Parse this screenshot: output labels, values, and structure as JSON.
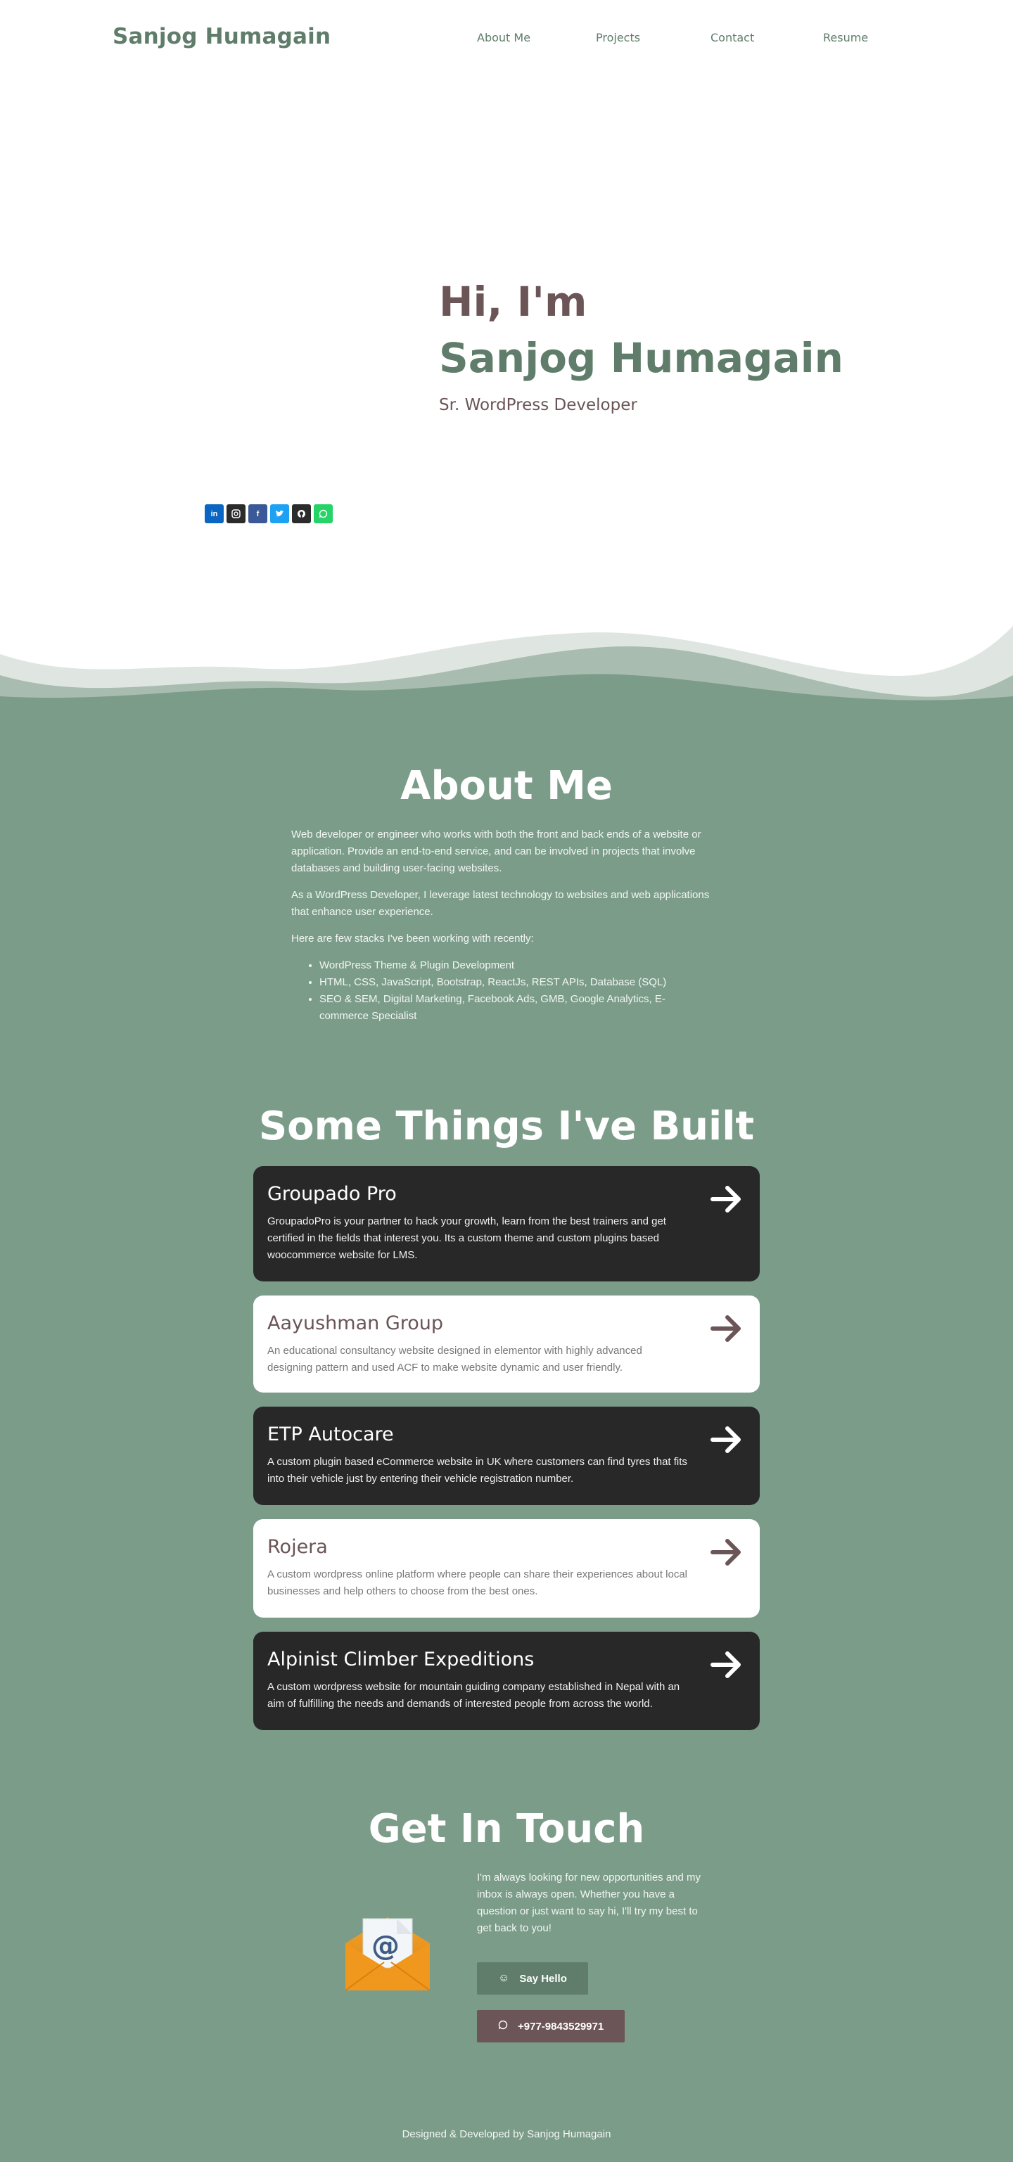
{
  "header": {
    "logo": "Sanjog Humagain",
    "nav": [
      {
        "label": "About Me"
      },
      {
        "label": "Projects"
      },
      {
        "label": "Contact"
      },
      {
        "label": "Resume"
      }
    ]
  },
  "hero": {
    "greeting": "Hi, I'm",
    "name": "Sanjog Humagain",
    "role": "Sr. WordPress Developer",
    "socials": [
      {
        "icon": "linkedin-icon",
        "color": "#0a66c2"
      },
      {
        "icon": "instagram-icon",
        "color": "#2b2b2b"
      },
      {
        "icon": "facebook-icon",
        "color": "#3b5998"
      },
      {
        "icon": "twitter-icon",
        "color": "#1da1f2"
      },
      {
        "icon": "github-icon",
        "color": "#2b2b2b"
      },
      {
        "icon": "whatsapp-icon",
        "color": "#25d366"
      }
    ]
  },
  "about": {
    "title": "About Me",
    "p1": "Web developer or engineer who works with both the front and back ends of a website or application. Provide an end-to-end service, and can be involved in projects that involve databases and building user-facing websites.",
    "p2": "As a WordPress Developer, I leverage latest technology to websites and web applications that enhance user experience.",
    "p3": "Here are few stacks I've been working with recently:",
    "stacks": [
      "WordPress Theme & Plugin Development",
      "HTML, CSS, JavaScript, Bootstrap, ReactJs, REST APIs, Database (SQL)",
      "SEO & SEM, Digital Marketing, Facebook Ads, GMB, Google Analytics, E-commerce Specialist"
    ]
  },
  "projects": {
    "title": "Some Things I've Built",
    "items": [
      {
        "title": "Groupado Pro",
        "desc": "GroupadoPro is your partner to hack your growth, learn from the best trainers and get certified in the fields that interest you. Its a custom theme and custom plugins based woocommerce website for LMS.",
        "style": "dark"
      },
      {
        "title": "Aayushman Group",
        "desc": "An educational consultancy website designed in elementor with highly advanced designing pattern and used ACF to make website dynamic and user friendly.",
        "style": "light"
      },
      {
        "title": "ETP Autocare",
        "desc": "A custom plugin based eCommerce website in UK where customers can find tyres that fits into their vehicle just by entering their vehicle registration number.",
        "style": "dark"
      },
      {
        "title": "Rojera",
        "desc": "A custom wordpress online platform where people can share their experiences about local businesses and help others to choose from the best ones.",
        "style": "light"
      },
      {
        "title": "Alpinist Climber Expeditions",
        "desc": "A custom wordpress website for mountain guiding company established in Nepal with an aim of fulfilling the needs and demands of interested people from across the world.",
        "style": "dark"
      }
    ]
  },
  "contact": {
    "title": "Get In Touch",
    "text": "I'm always looking for new opportunities and my inbox is always open. Whether you have a question or just want to say hi, I'll try my best to get back to you!",
    "say_hello": "Say Hello",
    "phone": "+977-9843529971"
  },
  "footer": {
    "text": "Designed & Developed by Sanjog Humagain"
  },
  "colors": {
    "brand_green": "#5f7d6a",
    "section_green": "#7c9c8a",
    "brand_brown": "#6b5556",
    "card_dark": "#282828"
  }
}
